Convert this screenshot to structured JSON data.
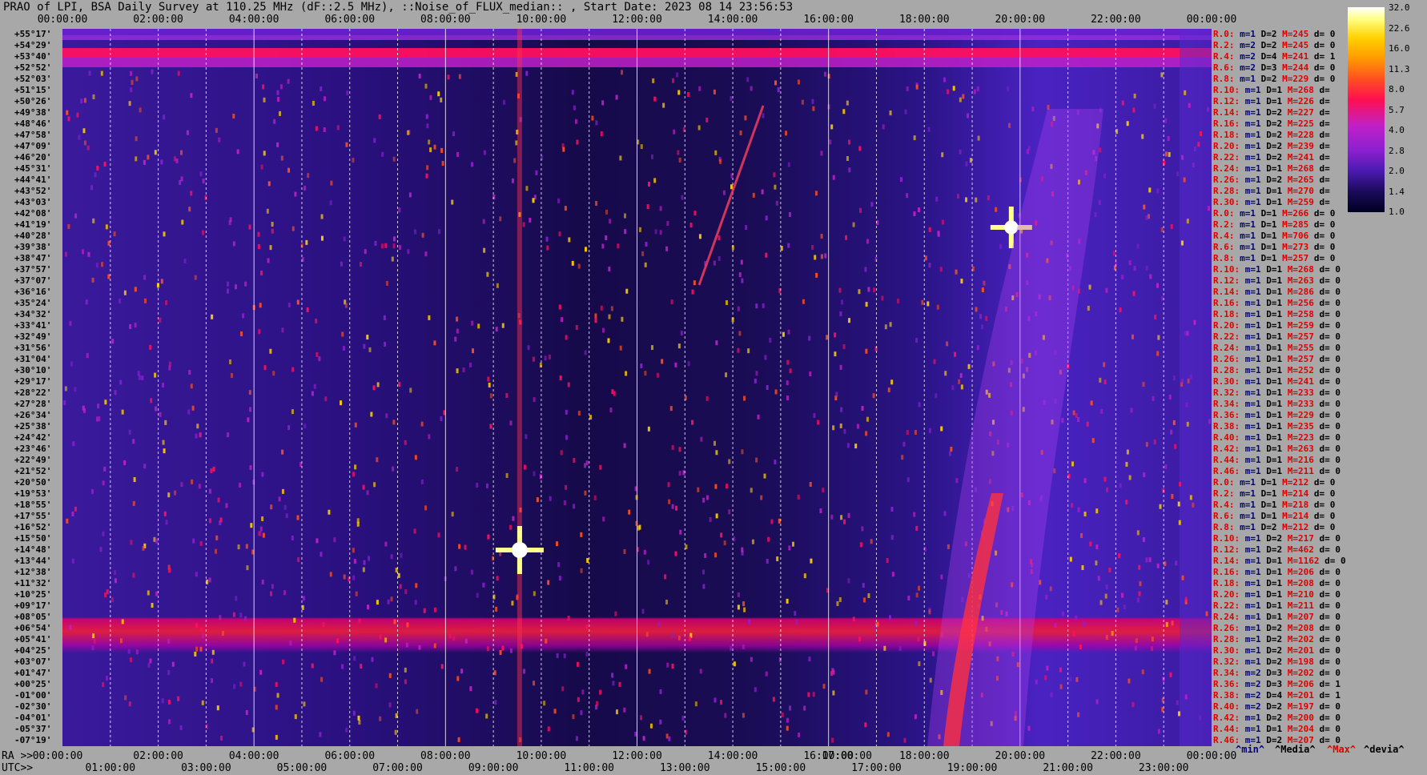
{
  "title": "PRAO of LPI, BSA Daily Survey at 110.25 MHz (dF::2.5 MHz), ::Noise_of_FLUX_median:: , Start Date: 2023 08 14 23:56:53",
  "top_axis_ticks": [
    "00:00:00",
    "02:00:00",
    "04:00:00",
    "06:00:00",
    "08:00:00",
    "10:00:00",
    "12:00:00",
    "14:00:00",
    "16:00:00",
    "18:00:00",
    "20:00:00",
    "22:00:00",
    "00:00:00"
  ],
  "declinations": [
    "+55°17'",
    "+54°29'",
    "+53°40'",
    "+52°52'",
    "+52°03'",
    "+51°15'",
    "+50°26'",
    "+49°38'",
    "+48°46'",
    "+47°58'",
    "+47°09'",
    "+46°20'",
    "+45°31'",
    "+44°41'",
    "+43°52'",
    "+43°03'",
    "+42°08'",
    "+41°19'",
    "+40°28'",
    "+39°38'",
    "+38°47'",
    "+37°57'",
    "+37°07'",
    "+36°16'",
    "+35°24'",
    "+34°32'",
    "+33°41'",
    "+32°49'",
    "+31°56'",
    "+31°04'",
    "+30°10'",
    "+29°17'",
    "+28°22'",
    "+27°28'",
    "+26°34'",
    "+25°38'",
    "+24°42'",
    "+23°46'",
    "+22°49'",
    "+21°52'",
    "+20°50'",
    "+19°53'",
    "+18°55'",
    "+17°55'",
    "+16°52'",
    "+15°50'",
    "+14°48'",
    "+13°44'",
    "+12°38'",
    "+11°32'",
    "+10°25'",
    "+09°17'",
    "+08°05'",
    "+06°54'",
    "+05°41'",
    "+04°25'",
    "+03°07'",
    "+01°47'",
    "+00°25'",
    "-01°00'",
    "-02°30'",
    "-04°01'",
    "-05°37'",
    "-07°19'"
  ],
  "row_labels": [
    {
      "r": "R.0:",
      "m": "m=1",
      "d": "D=2",
      "h": "M=245",
      "dv": "d= 0"
    },
    {
      "r": "R.2:",
      "m": "m=2",
      "d": "D=2",
      "h": "M=245",
      "dv": "d= 0"
    },
    {
      "r": "R.4:",
      "m": "m=2",
      "d": "D=4",
      "h": "M=241",
      "dv": "d= 1"
    },
    {
      "r": "R.6:",
      "m": "m=2",
      "d": "D=3",
      "h": "M=244",
      "dv": "d= 0"
    },
    {
      "r": "R.8:",
      "m": "m=1",
      "d": "D=2",
      "h": "M=229",
      "dv": "d= 0"
    },
    {
      "r": "R.10:",
      "m": "m=1",
      "d": "D=1",
      "h": "M=268",
      "dv": "d="
    },
    {
      "r": "R.12:",
      "m": "m=1",
      "d": "D=1",
      "h": "M=226",
      "dv": "d="
    },
    {
      "r": "R.14:",
      "m": "m=1",
      "d": "D=2",
      "h": "M=227",
      "dv": "d="
    },
    {
      "r": "R.16:",
      "m": "m=1",
      "d": "D=2",
      "h": "M=225",
      "dv": "d="
    },
    {
      "r": "R.18:",
      "m": "m=1",
      "d": "D=2",
      "h": "M=228",
      "dv": "d="
    },
    {
      "r": "R.20:",
      "m": "m=1",
      "d": "D=2",
      "h": "M=239",
      "dv": "d="
    },
    {
      "r": "R.22:",
      "m": "m=1",
      "d": "D=2",
      "h": "M=241",
      "dv": "d="
    },
    {
      "r": "R.24:",
      "m": "m=1",
      "d": "D=1",
      "h": "M=268",
      "dv": "d="
    },
    {
      "r": "R.26:",
      "m": "m=1",
      "d": "D=2",
      "h": "M=265",
      "dv": "d="
    },
    {
      "r": "R.28:",
      "m": "m=1",
      "d": "D=1",
      "h": "M=270",
      "dv": "d="
    },
    {
      "r": "R.30:",
      "m": "m=1",
      "d": "D=1",
      "h": "M=259",
      "dv": "d="
    },
    {
      "r": "R.0:",
      "m": "m=1",
      "d": "D=1",
      "h": "M=266",
      "dv": "d= 0"
    },
    {
      "r": "R.2:",
      "m": "m=1",
      "d": "D=1",
      "h": "M=285",
      "dv": "d= 0"
    },
    {
      "r": "R.4:",
      "m": "m=1",
      "d": "D=1",
      "h": "M=706",
      "dv": "d= 0"
    },
    {
      "r": "R.6:",
      "m": "m=1",
      "d": "D=1",
      "h": "M=273",
      "dv": "d= 0"
    },
    {
      "r": "R.8:",
      "m": "m=1",
      "d": "D=1",
      "h": "M=257",
      "dv": "d= 0"
    },
    {
      "r": "R.10:",
      "m": "m=1",
      "d": "D=1",
      "h": "M=268",
      "dv": "d= 0"
    },
    {
      "r": "R.12:",
      "m": "m=1",
      "d": "D=1",
      "h": "M=263",
      "dv": "d= 0"
    },
    {
      "r": "R.14:",
      "m": "m=1",
      "d": "D=1",
      "h": "M=286",
      "dv": "d= 0"
    },
    {
      "r": "R.16:",
      "m": "m=1",
      "d": "D=1",
      "h": "M=256",
      "dv": "d= 0"
    },
    {
      "r": "R.18:",
      "m": "m=1",
      "d": "D=1",
      "h": "M=258",
      "dv": "d= 0"
    },
    {
      "r": "R.20:",
      "m": "m=1",
      "d": "D=1",
      "h": "M=259",
      "dv": "d= 0"
    },
    {
      "r": "R.22:",
      "m": "m=1",
      "d": "D=1",
      "h": "M=257",
      "dv": "d= 0"
    },
    {
      "r": "R.24:",
      "m": "m=1",
      "d": "D=1",
      "h": "M=255",
      "dv": "d= 0"
    },
    {
      "r": "R.26:",
      "m": "m=1",
      "d": "D=1",
      "h": "M=257",
      "dv": "d= 0"
    },
    {
      "r": "R.28:",
      "m": "m=1",
      "d": "D=1",
      "h": "M=252",
      "dv": "d= 0"
    },
    {
      "r": "R.30:",
      "m": "m=1",
      "d": "D=1",
      "h": "M=241",
      "dv": "d= 0"
    },
    {
      "r": "R.32:",
      "m": "m=1",
      "d": "D=1",
      "h": "M=233",
      "dv": "d= 0"
    },
    {
      "r": "R.34:",
      "m": "m=1",
      "d": "D=1",
      "h": "M=233",
      "dv": "d= 0"
    },
    {
      "r": "R.36:",
      "m": "m=1",
      "d": "D=1",
      "h": "M=229",
      "dv": "d= 0"
    },
    {
      "r": "R.38:",
      "m": "m=1",
      "d": "D=1",
      "h": "M=235",
      "dv": "d= 0"
    },
    {
      "r": "R.40:",
      "m": "m=1",
      "d": "D=1",
      "h": "M=223",
      "dv": "d= 0"
    },
    {
      "r": "R.42:",
      "m": "m=1",
      "d": "D=1",
      "h": "M=263",
      "dv": "d= 0"
    },
    {
      "r": "R.44:",
      "m": "m=1",
      "d": "D=1",
      "h": "M=216",
      "dv": "d= 0"
    },
    {
      "r": "R.46:",
      "m": "m=1",
      "d": "D=1",
      "h": "M=211",
      "dv": "d= 0"
    },
    {
      "r": "R.0:",
      "m": "m=1",
      "d": "D=1",
      "h": "M=212",
      "dv": "d= 0"
    },
    {
      "r": "R.2:",
      "m": "m=1",
      "d": "D=1",
      "h": "M=214",
      "dv": "d= 0"
    },
    {
      "r": "R.4:",
      "m": "m=1",
      "d": "D=1",
      "h": "M=218",
      "dv": "d= 0"
    },
    {
      "r": "R.6:",
      "m": "m=1",
      "d": "D=1",
      "h": "M=214",
      "dv": "d= 0"
    },
    {
      "r": "R.8:",
      "m": "m=1",
      "d": "D=2",
      "h": "M=212",
      "dv": "d= 0"
    },
    {
      "r": "R.10:",
      "m": "m=1",
      "d": "D=2",
      "h": "M=217",
      "dv": "d= 0"
    },
    {
      "r": "R.12:",
      "m": "m=1",
      "d": "D=2",
      "h": "M=462",
      "dv": "d= 0"
    },
    {
      "r": "R.14:",
      "m": "m=1",
      "d": "D=1",
      "h": "M=1162",
      "dv": "d= 0"
    },
    {
      "r": "R.16:",
      "m": "m=1",
      "d": "D=1",
      "h": "M=206",
      "dv": "d= 0"
    },
    {
      "r": "R.18:",
      "m": "m=1",
      "d": "D=1",
      "h": "M=208",
      "dv": "d= 0"
    },
    {
      "r": "R.20:",
      "m": "m=1",
      "d": "D=1",
      "h": "M=210",
      "dv": "d= 0"
    },
    {
      "r": "R.22:",
      "m": "m=1",
      "d": "D=1",
      "h": "M=211",
      "dv": "d= 0"
    },
    {
      "r": "R.24:",
      "m": "m=1",
      "d": "D=1",
      "h": "M=207",
      "dv": "d= 0"
    },
    {
      "r": "R.26:",
      "m": "m=1",
      "d": "D=2",
      "h": "M=208",
      "dv": "d= 0"
    },
    {
      "r": "R.28:",
      "m": "m=1",
      "d": "D=2",
      "h": "M=202",
      "dv": "d= 0"
    },
    {
      "r": "R.30:",
      "m": "m=1",
      "d": "D=2",
      "h": "M=201",
      "dv": "d= 0"
    },
    {
      "r": "R.32:",
      "m": "m=1",
      "d": "D=2",
      "h": "M=198",
      "dv": "d= 0"
    },
    {
      "r": "R.34:",
      "m": "m=2",
      "d": "D=3",
      "h": "M=202",
      "dv": "d= 0"
    },
    {
      "r": "R.36:",
      "m": "m=2",
      "d": "D=3",
      "h": "M=206",
      "dv": "d= 1"
    },
    {
      "r": "R.38:",
      "m": "m=2",
      "d": "D=4",
      "h": "M=201",
      "dv": "d= 1"
    },
    {
      "r": "R.40:",
      "m": "m=2",
      "d": "D=2",
      "h": "M=197",
      "dv": "d= 0"
    },
    {
      "r": "R.42:",
      "m": "m=1",
      "d": "D=2",
      "h": "M=200",
      "dv": "d= 0"
    },
    {
      "r": "R.44:",
      "m": "m=1",
      "d": "D=1",
      "h": "M=204",
      "dv": "d= 0"
    },
    {
      "r": "R.46:",
      "m": "m=1",
      "d": "D=2",
      "h": "M=207",
      "dv": "d= 0"
    }
  ],
  "colorbar_labels": [
    "32.0",
    "22.6",
    "16.0",
    "11.3",
    "8.0",
    "5.7",
    "4.0",
    "2.8",
    "2.0",
    "1.4",
    "1.0"
  ],
  "bottom": {
    "ra_prefix": "RA >>",
    "utc_prefix": "UTC>>",
    "ra_ticks": [
      "00:00:00",
      "02:00:00",
      "04:00:00",
      "06:00:00",
      "08:00:00",
      "10:00:00",
      "12:00:00",
      "14:00:00",
      "16:00:00",
      "17:00:00",
      "18:00:00",
      "20:00:00",
      "22:00:00",
      "00:00:00"
    ],
    "utc_ticks": [
      "01:00:00",
      "03:00:00",
      "05:00:00",
      "07:00:00",
      "09:00:00",
      "11:00:00",
      "13:00:00",
      "15:00:00",
      "17:00:00",
      "19:00:00",
      "21:00:00",
      "23:00:00"
    ]
  },
  "legend": {
    "min": "^min^",
    "median": "^Media^",
    "max": "^Max^",
    "devia": "^devia^"
  },
  "colors": {
    "min": "#000080",
    "median": "#000000",
    "max": "#e00000",
    "devia": "#000000"
  },
  "chart_data": {
    "type": "heatmap",
    "title": "PRAO of LPI, BSA Daily Survey at 110.25 MHz (dF::2.5 MHz), ::Noise_of_FLUX_median:: , Start Date: 2023 08 14 23:56:53",
    "colorscale_range": [
      1.0,
      32.0
    ],
    "sources": [
      {
        "utc": "10:00",
        "dec": "+14°48'"
      },
      {
        "utc": "20:00",
        "dec": "+40°28'"
      }
    ]
  }
}
